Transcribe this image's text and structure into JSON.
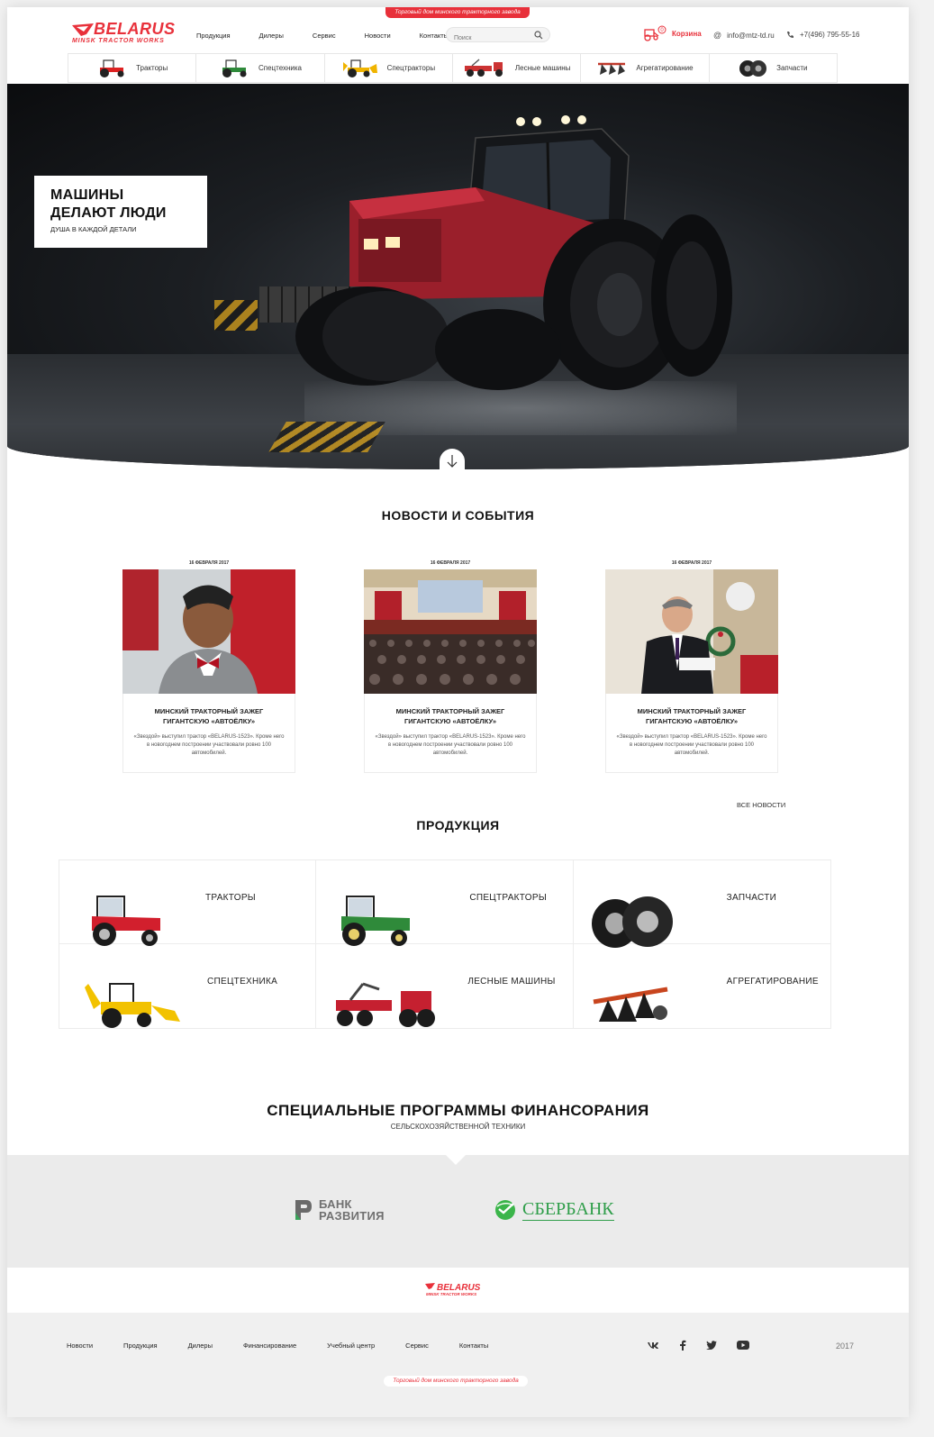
{
  "header": {
    "ribbon": "Торговый дом минского тракторного завода",
    "logo_main": "BELARUS",
    "logo_sub": "MINSK TRACTOR WORKS",
    "nav": [
      "Продукция",
      "Дилеры",
      "Сервис",
      "Новости",
      "Контакты"
    ],
    "search_placeholder": "Поиск",
    "cart_label": "Корзина",
    "cart_count": "0",
    "email": "info@mtz-td.ru",
    "phone": "+7(496) 795-55-16"
  },
  "categories": [
    "Тракторы",
    "Спецтехника",
    "Спецтракторы",
    "Лесные машины",
    "Агрегатирование",
    "Запчасти"
  ],
  "hero": {
    "title": "МАШИНЫ\nДЕЛАЮТ ЛЮДИ",
    "subtitle": "ДУША В КАЖДОЙ ДЕТАЛИ"
  },
  "news": {
    "heading": "НОВОСТИ И СОБЫТИЯ",
    "all_link": "ВСЕ НОВОСТИ",
    "items": [
      {
        "date": "16 ФЕВРАЛЯ 2017",
        "title": "МИНСКИЙ ТРАКТОРНЫЙ ЗАЖЕГ ГИГАНТСКУЮ «АВТОЁЛКУ»",
        "text": "«Звездой» выступил трактор «BELARUS-1523». Кроме него в новогоднем построении участвовали ровно 100 автомобилей."
      },
      {
        "date": "16 ФЕВРАЛЯ 2017",
        "title": "МИНСКИЙ ТРАКТОРНЫЙ ЗАЖЕГ ГИГАНТСКУЮ «АВТОЁЛКУ»",
        "text": "«Звездой» выступил трактор «BELARUS-1523». Кроме него в новогоднем построении участвовали ровно 100 автомобилей."
      },
      {
        "date": "16 ФЕВРАЛЯ 2017",
        "title": "МИНСКИЙ ТРАКТОРНЫЙ ЗАЖЕГ ГИГАНТСКУЮ «АВТОЁЛКУ»",
        "text": "«Звездой» выступил трактор «BELARUS-1523». Кроме него в новогоднем построении участвовали ровно 100 автомобилей."
      }
    ]
  },
  "products": {
    "heading": "ПРОДУКЦИЯ",
    "items": [
      "ТРАКТОРЫ",
      "СПЕЦТРАКТОРЫ",
      "ЗАПЧАСТИ",
      "СПЕЦТЕХНИКА",
      "ЛЕСНЫЕ МАШИНЫ",
      "АГРЕГАТИРОВАНИЕ"
    ]
  },
  "finance": {
    "heading": "СПЕЦИАЛЬНЫЕ ПРОГРАММЫ ФИНАНСОРАНИЯ",
    "subheading": "СЕЛЬСКОХОЗЯЙСТВЕННОЙ ТЕХНИКИ",
    "bank1": "БАНК\nРАЗВИТИЯ",
    "bank2": "СБЕРБАНК"
  },
  "footer": {
    "nav": [
      "Новости",
      "Продукция",
      "Дилеры",
      "Финансирование",
      "Учебный центр",
      "Сервис",
      "Контакты"
    ],
    "year": "2017",
    "ribbon": "Торговый дом минского тракторного завода",
    "social_icons": [
      "vk-icon",
      "facebook-icon",
      "twitter-icon",
      "youtube-icon"
    ]
  },
  "colors": {
    "brand_red": "#e8303a",
    "sber_green": "#2f9e4a"
  }
}
